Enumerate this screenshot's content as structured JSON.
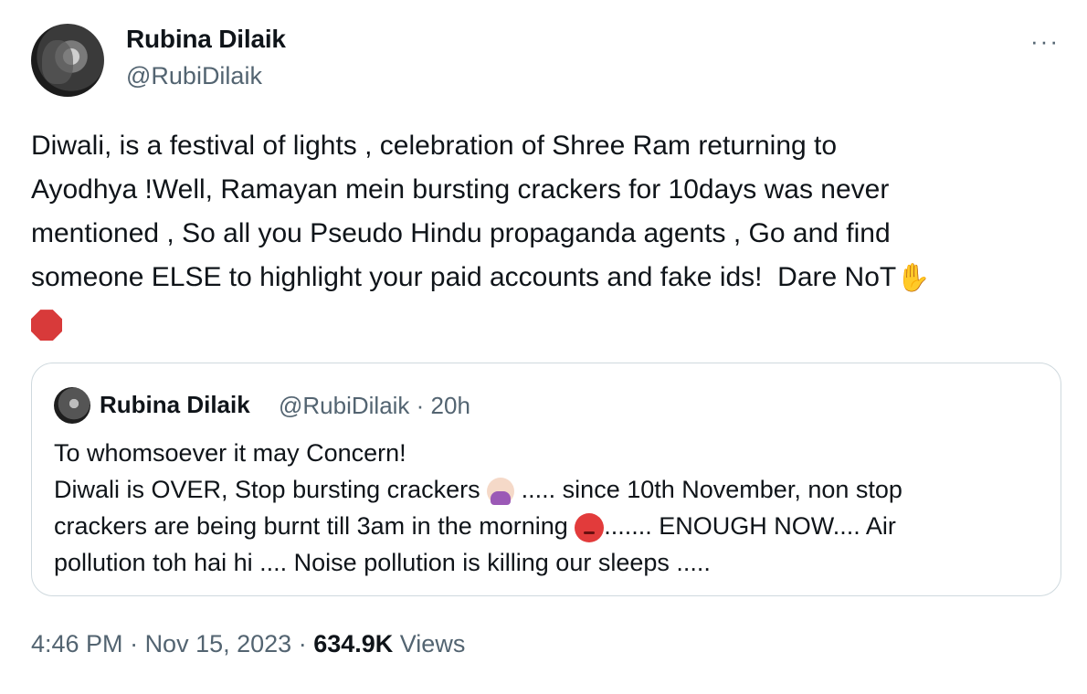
{
  "author": {
    "name": "Rubina Dilaik",
    "handle": "@RubiDilaik"
  },
  "more_label": "···",
  "tweet": {
    "line1": "Diwali, is a festival of lights , celebration of Shree Ram returning to",
    "line2": "Ayodhya !Well, Ramayan mein bursting crackers for 10days was never",
    "line3": "mentioned , So all you Pseudo Hindu propaganda agents , Go and find",
    "line4": "someone ELSE to highlight your paid accounts and fake ids!  Dare NoT",
    "hand_emoji": "✋",
    "stop_icon": "stop-sign"
  },
  "quote": {
    "name": "Rubina Dilaik",
    "handle": "@RubiDilaik",
    "time": "20h",
    "line1": "To whomsoever it may Concern!",
    "line2a": "Diwali is OVER, Stop bursting crackers ",
    "line2b": "..... since 10th November, non stop",
    "line3a": "crackers are being burnt till 3am in the morning ",
    "line3b": "....... ENOUGH NOW.... Air",
    "line4": "pollution toh hai hi ....  Noise pollution is killing our sleeps .....",
    "emoji1": "woman-gesturing-no",
    "emoji2": "angry-face"
  },
  "footer": {
    "time": "4:46 PM",
    "date": "Nov 15, 2023",
    "views_count": "634.9K",
    "views_label": "Views"
  }
}
